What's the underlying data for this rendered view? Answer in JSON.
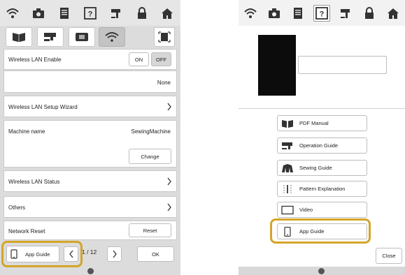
{
  "left_screen": {
    "status_icons": [
      "wifi-icon",
      "camera-icon",
      "document-icon",
      "help-icon",
      "sewing-machine-icon",
      "lock-icon",
      "home-icon"
    ],
    "tabs": [
      "book-tab",
      "machine-tab",
      "embroidery-tab",
      "wifi-tab",
      "scan-tab"
    ],
    "wireless_enable": {
      "label": "Wireless LAN Enable",
      "on_label": "ON",
      "off_label": "OFF",
      "selected": "OFF"
    },
    "network_value": "None",
    "setup_wizard_label": "Wireless LAN Setup Wizard",
    "machine_name": {
      "label": "Machine name",
      "value": "SewingMachine",
      "change_label": "Change"
    },
    "status_label": "Wireless LAN Status",
    "others_label": "Others",
    "network_reset": {
      "label": "Network Reset",
      "reset_label": "Reset"
    },
    "bottom": {
      "app_guide_label": "App Guide",
      "page_text": "1 / 12",
      "ok_label": "OK"
    }
  },
  "right_screen": {
    "status_icons": [
      "wifi-icon",
      "camera-icon",
      "document-icon",
      "help-icon",
      "sewing-machine-icon",
      "lock-icon",
      "home-icon"
    ],
    "menu_items": [
      "PDF Manual",
      "Operation Guide",
      "Sewing Guide",
      "Pattern Explanation",
      "Video",
      "App Guide"
    ],
    "close_label": "Close"
  },
  "colors": {
    "highlight": "#d4a528",
    "panel_gray": "#dcdcdc",
    "button_border": "#bdbdbd"
  }
}
